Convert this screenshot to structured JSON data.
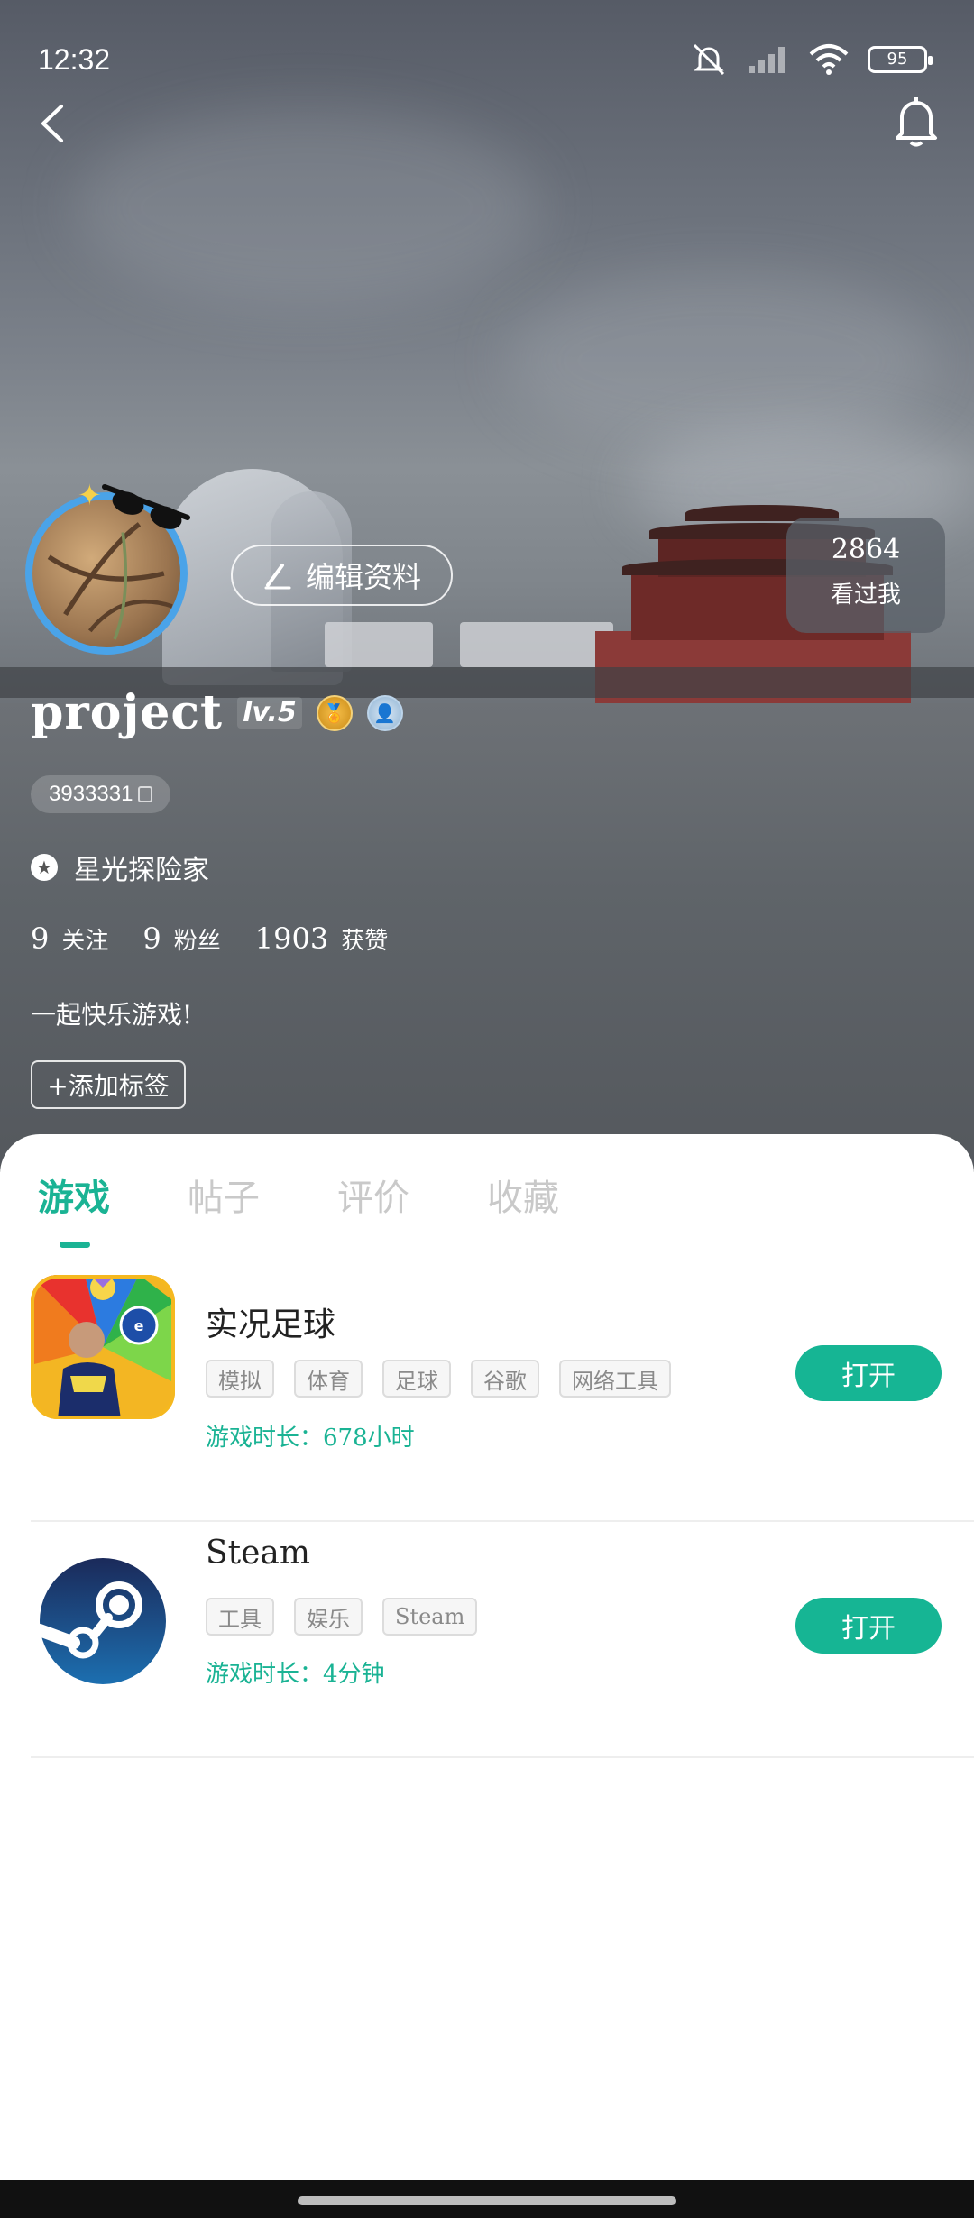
{
  "status_bar": {
    "time": "12:32",
    "battery": "95",
    "icons": [
      "mute-icon",
      "signal-icon",
      "wifi-icon",
      "battery-icon"
    ]
  },
  "header": {
    "back_icon": "chevron-left-icon",
    "notification_icon": "bell-icon"
  },
  "profile": {
    "username": "project",
    "level": "lv.5",
    "uid": "3933331",
    "title": "星光探险家",
    "edit_label": "编辑资料",
    "visitor": {
      "count": "2864",
      "label": "看过我"
    },
    "stats": [
      {
        "value": "9",
        "label": "关注"
      },
      {
        "value": "9",
        "label": "粉丝"
      },
      {
        "value": "1903",
        "label": "获赞"
      }
    ],
    "bio": "一起快乐游戏!",
    "add_tag_label": "+添加标签"
  },
  "tabs": [
    {
      "label": "游戏",
      "active": true
    },
    {
      "label": "帖子",
      "active": false
    },
    {
      "label": "评价",
      "active": false
    },
    {
      "label": "收藏",
      "active": false
    }
  ],
  "games": [
    {
      "name": "实况足球",
      "tags": [
        "模拟",
        "体育",
        "足球",
        "谷歌",
        "网络工具"
      ],
      "playtime": "游戏时长：678小时",
      "action": "打开",
      "icon": "efootball-icon"
    },
    {
      "name": "Steam",
      "tags": [
        "工具",
        "娱乐",
        "Steam"
      ],
      "playtime": "游戏时长：4分钟",
      "action": "打开",
      "icon": "steam-icon"
    }
  ],
  "colors": {
    "accent": "#1ab394",
    "button": "#16b594",
    "avatar_ring": "#4aa3e8"
  }
}
